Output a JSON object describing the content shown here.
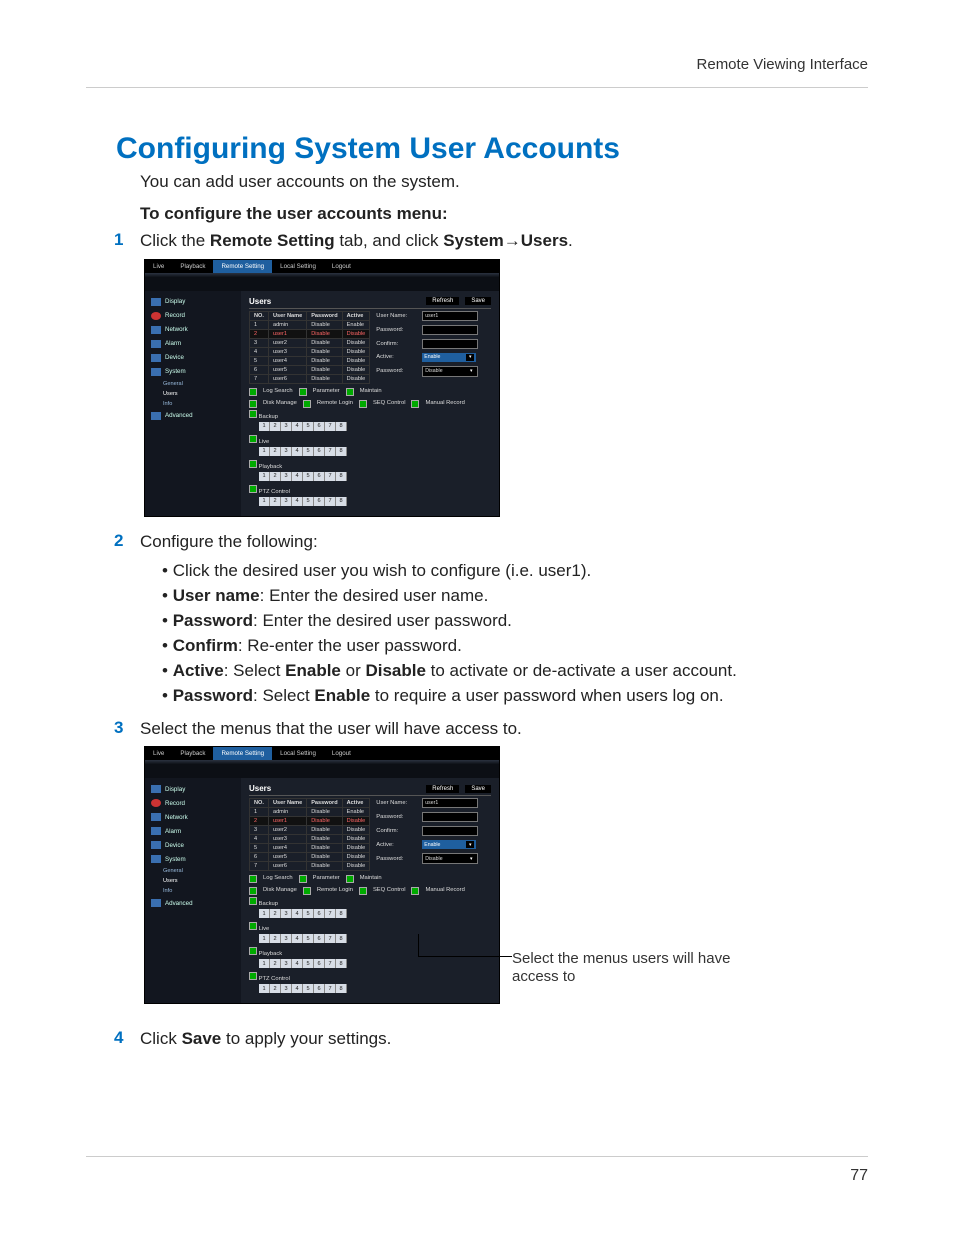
{
  "header": "Remote Viewing Interface",
  "title": "Configuring System User Accounts",
  "intro": "You can add user accounts on the system.",
  "subhead": "To configure the user accounts menu:",
  "step1_pre": "Click the ",
  "step1_b1": "Remote Setting",
  "step1_mid": " tab, and click ",
  "step1_b2": "System",
  "step1_arrow": "→",
  "step1_b3": "Users",
  "step1_post": ".",
  "step2": "Configure the following:",
  "b1": "Click the desired user you wish to configure (i.e. user1).",
  "b2a": "User name",
  "b2b": ": Enter the desired user name.",
  "b3a": "Password",
  "b3b": ": Enter the desired user password.",
  "b4a": "Confirm",
  "b4b": ": Re-enter the user password.",
  "b5a": "Active",
  "b5b": ": Select ",
  "b5c": "Enable",
  "b5d": " or ",
  "b5e": "Disable",
  "b5f": " to activate or de-activate a user account.",
  "b6a": "Password",
  "b6b": ": Select ",
  "b6c": "Enable",
  "b6d": " to require a user password when users log on.",
  "step3": "Select the menus that the user will have access to.",
  "step4_pre": "Click ",
  "step4_b": "Save",
  "step4_post": " to apply your settings.",
  "callout": "Select the menus users will have access to",
  "pagenum": "77",
  "shot": {
    "tabs": [
      "Live",
      "Playback",
      "Remote Setting",
      "Local Setting",
      "Logout"
    ],
    "active_tab": 2,
    "sidebar": [
      "Display",
      "Record",
      "Network",
      "Alarm",
      "Device",
      "System",
      "Advanced"
    ],
    "system_subs": [
      "General",
      "Users",
      "Info"
    ],
    "panel_title": "Users",
    "btn_refresh": "Refresh",
    "btn_save": "Save",
    "cols": [
      "NO.",
      "User Name",
      "Password",
      "Active"
    ],
    "rows": [
      [
        "1",
        "admin",
        "Disable",
        "Enable"
      ],
      [
        "2",
        "user1",
        "Disable",
        "Disable"
      ],
      [
        "3",
        "user2",
        "Disable",
        "Disable"
      ],
      [
        "4",
        "user3",
        "Disable",
        "Disable"
      ],
      [
        "5",
        "user4",
        "Disable",
        "Disable"
      ],
      [
        "6",
        "user5",
        "Disable",
        "Disable"
      ],
      [
        "7",
        "user6",
        "Disable",
        "Disable"
      ]
    ],
    "form": {
      "lab_user": "User Name:",
      "val_user": "user1",
      "lab_pass": "Password:",
      "lab_conf": "Confirm:",
      "lab_active": "Active:",
      "val_active": "Enable",
      "lab_pwsel": "Password:",
      "val_pwsel": "Disable"
    },
    "perm_row1": [
      "Log Search",
      "Parameter",
      "Maintain"
    ],
    "perm_row2": [
      "Disk Manage",
      "Remote Login",
      "SEQ Control",
      "Manual Record"
    ],
    "sections": [
      "Backup",
      "Live",
      "Playback",
      "PTZ Control"
    ],
    "nums": [
      "1",
      "2",
      "3",
      "4",
      "5",
      "6",
      "7",
      "8"
    ]
  }
}
